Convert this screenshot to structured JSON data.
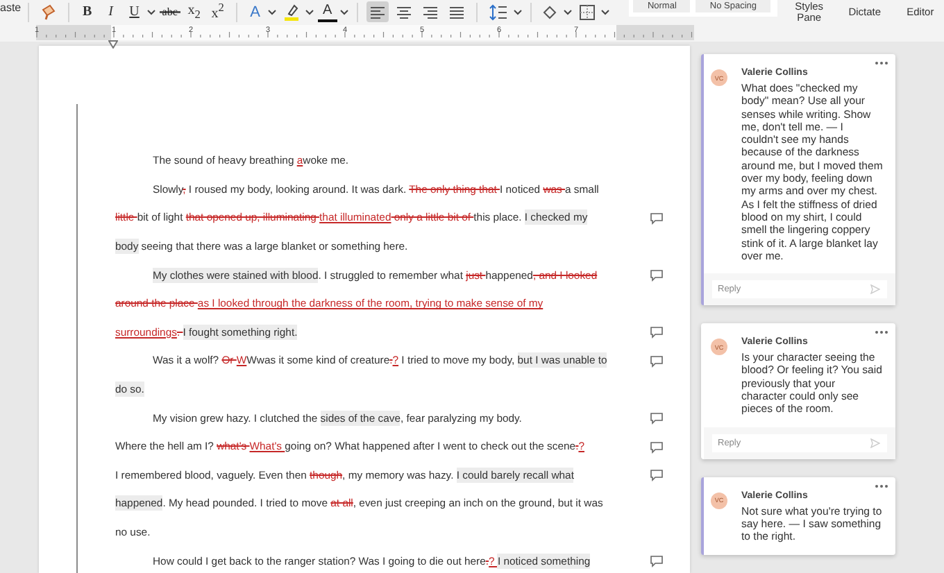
{
  "toolbar": {
    "paste_label": "aste",
    "groups": [
      [
        {
          "kind": "painter",
          "selected": false
        }
      ],
      [
        {
          "kind": "bold",
          "label": "B",
          "selected": false
        },
        {
          "kind": "italic",
          "label": "I",
          "selected": false
        },
        {
          "kind": "underline",
          "label": "U",
          "dropdown": true,
          "selected": false
        },
        {
          "kind": "strike",
          "label": "abc",
          "selected": false
        },
        {
          "kind": "subscript",
          "label": "x$_{2}$",
          "selected": false
        },
        {
          "kind": "superscript",
          "label": "x$^{2}$",
          "selected": false
        }
      ],
      [
        {
          "kind": "text-effect",
          "label": "A",
          "dropdown": true,
          "selected": false
        },
        {
          "kind": "highlight",
          "dropdown": true,
          "selected": false
        },
        {
          "kind": "font-color",
          "label": "A",
          "dropdown": true,
          "selected": false
        }
      ],
      [
        {
          "kind": "align-left",
          "selected": true
        },
        {
          "kind": "align-center",
          "selected": false
        },
        {
          "kind": "align-right",
          "selected": false
        },
        {
          "kind": "justify",
          "selected": false
        }
      ],
      [
        {
          "kind": "line-spacing",
          "dropdown": true,
          "selected": false
        }
      ],
      [
        {
          "kind": "shading",
          "dropdown": true,
          "selected": false
        },
        {
          "kind": "borders",
          "dropdown": true,
          "selected": false
        }
      ]
    ],
    "styles": [
      "Normal",
      "No Spacing"
    ],
    "buttons": [
      "Styles Pane",
      "Dictate",
      "Editor"
    ]
  },
  "ruler": {
    "labels": [
      "1",
      "1",
      "2",
      "3",
      "4",
      "5",
      "6",
      "7"
    ]
  },
  "document": {
    "lines": [
      {
        "indent": true,
        "comment_marker": false,
        "segments": [
          {
            "kind": "plain",
            "text": "The sound of heavy breathing "
          },
          {
            "kind": "inserted",
            "text": "a"
          },
          {
            "kind": "plain",
            "text": "woke me."
          }
        ]
      },
      {
        "indent": true,
        "comment_marker": false,
        "segments": [
          {
            "kind": "plain",
            "text": "Slowly"
          },
          {
            "kind": "deleted",
            "text": ","
          },
          {
            "kind": "plain",
            "text": " I roused my body, looking around. It was dark. "
          },
          {
            "kind": "deleted",
            "text": "The only thing that "
          },
          {
            "kind": "plain",
            "text": "I noticed "
          },
          {
            "kind": "deleted",
            "text": "was "
          },
          {
            "kind": "plain",
            "text": "a small"
          }
        ]
      },
      {
        "indent": false,
        "comment_marker": true,
        "segments": [
          {
            "kind": "deleted",
            "text": "little "
          },
          {
            "kind": "plain",
            "text": "bit of light "
          },
          {
            "kind": "deleted",
            "text": "that opened up, illuminating "
          },
          {
            "kind": "inserted",
            "text": "that illuminated"
          },
          {
            "kind": "deleted",
            "text": " only a little bit of "
          },
          {
            "kind": "plain",
            "text": "this place. "
          },
          {
            "kind": "commented",
            "text": "I checked my"
          }
        ]
      },
      {
        "indent": false,
        "comment_marker": false,
        "segments": [
          {
            "kind": "commented",
            "text": "body"
          },
          {
            "kind": "plain",
            "text": " seeing that there was a large blanket or something here."
          }
        ]
      },
      {
        "indent": true,
        "comment_marker": true,
        "segments": [
          {
            "kind": "commented",
            "text": "My clothes were stained with blood"
          },
          {
            "kind": "plain",
            "text": ". I struggled to remember what "
          },
          {
            "kind": "deleted",
            "text": "just "
          },
          {
            "kind": "plain",
            "text": "happened"
          },
          {
            "kind": "deleted",
            "text": ", and I looked"
          }
        ]
      },
      {
        "indent": false,
        "comment_marker": false,
        "segments": [
          {
            "kind": "deleted",
            "text": "around the place "
          },
          {
            "kind": "inserted",
            "text": "as I looked through the darkness of the room, trying to make sense of my"
          }
        ]
      },
      {
        "indent": false,
        "comment_marker": true,
        "segments": [
          {
            "kind": "inserted",
            "text": "surroundings"
          },
          {
            "kind": "deleted",
            "text": ". "
          },
          {
            "kind": "commented",
            "text": "I fought something right."
          }
        ]
      },
      {
        "indent": true,
        "comment_marker": true,
        "segments": [
          {
            "kind": "plain",
            "text": "Was it a wolf? "
          },
          {
            "kind": "deleted",
            "text": "Or "
          },
          {
            "kind": "inserted",
            "text": "W"
          },
          {
            "kind": "plain",
            "text": "Wwas it some kind of creature"
          },
          {
            "kind": "deleted",
            "text": "."
          },
          {
            "kind": "inserted",
            "text": "?"
          },
          {
            "kind": "plain",
            "text": " I tried to move my body, "
          },
          {
            "kind": "commented",
            "text": "but I was unable to"
          }
        ]
      },
      {
        "indent": false,
        "comment_marker": false,
        "segments": [
          {
            "kind": "commented",
            "text": "do so."
          }
        ]
      },
      {
        "indent": true,
        "comment_marker": true,
        "segments": [
          {
            "kind": "plain",
            "text": "My vision grew hazy. I clutched the "
          },
          {
            "kind": "commented",
            "text": "sides of the cave"
          },
          {
            "kind": "plain",
            "text": ", fear paralyzing my body."
          }
        ]
      },
      {
        "indent": false,
        "comment_marker": true,
        "segments": [
          {
            "kind": "plain",
            "text": "Where the hell am I? "
          },
          {
            "kind": "deleted",
            "text": "what's "
          },
          {
            "kind": "inserted",
            "text": "What's "
          },
          {
            "kind": "plain",
            "text": "going on? What happened after I went to check out the scene"
          },
          {
            "kind": "deleted",
            "text": "."
          },
          {
            "kind": "inserted",
            "text": "?"
          }
        ]
      },
      {
        "indent": false,
        "comment_marker": true,
        "segments": [
          {
            "kind": "plain",
            "text": "I remembered blood, vaguely. Even then "
          },
          {
            "kind": "deleted",
            "text": "though"
          },
          {
            "kind": "plain",
            "text": ", my memory was hazy. "
          },
          {
            "kind": "commented",
            "text": "I could barely recall what"
          }
        ]
      },
      {
        "indent": false,
        "comment_marker": false,
        "segments": [
          {
            "kind": "commented",
            "text": "happened"
          },
          {
            "kind": "plain",
            "text": ". My head pounded. I tried to move "
          },
          {
            "kind": "deleted",
            "text": "at all"
          },
          {
            "kind": "plain",
            "text": ", even just creeping an inch on the ground, but it was"
          }
        ]
      },
      {
        "indent": false,
        "comment_marker": false,
        "segments": [
          {
            "kind": "plain",
            "text": "no use."
          }
        ]
      },
      {
        "indent": true,
        "comment_marker": true,
        "segments": [
          {
            "kind": "plain",
            "text": "How could I get back to the ranger station? Was I going to die out here"
          },
          {
            "kind": "deleted",
            "text": "."
          },
          {
            "kind": "inserted",
            "text": "? "
          },
          {
            "kind": "commented",
            "text": "I noticed something"
          }
        ]
      }
    ]
  },
  "comments": [
    {
      "initials": "VC",
      "author": "Valerie Collins",
      "selected": true,
      "text": "What does \"checked my body\" mean? Use all your senses while writing. Show me, don't tell me. — I couldn't see my hands because of the darkness around me, but I moved them over my body, feeling down my arms and over my chest. As I felt the stiffness of dried blood on my shirt, I could smell the lingering coppery stink of it. A large blanket lay over me.",
      "reply_placeholder": "Reply"
    },
    {
      "initials": "VC",
      "author": "Valerie Collins",
      "selected": false,
      "text": "Is your character seeing the blood? Or feeling it? You said previously that your character could only see pieces of the room.",
      "reply_placeholder": "Reply"
    },
    {
      "initials": "VC",
      "author": "Valerie Collins",
      "selected": true,
      "text": "Not sure what you're trying to say here. — I saw something to the right."
    }
  ]
}
